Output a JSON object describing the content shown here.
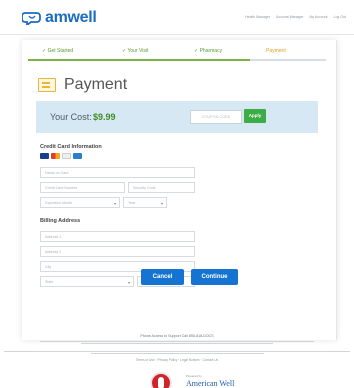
{
  "header": {
    "logo_text": "amwell",
    "links": [
      "Health Manager",
      "Account Manager",
      "My Account",
      "Log Out"
    ]
  },
  "steps": [
    {
      "label": "✓ Get Started",
      "state": "done"
    },
    {
      "label": "✓ Your Visit",
      "state": "done"
    },
    {
      "label": "✓ Pharmacy",
      "state": "done"
    },
    {
      "label": "Payment",
      "state": "active"
    }
  ],
  "page_title": "Payment",
  "cost": {
    "label": "Your Cost:",
    "amount": "$9.99",
    "coupon_placeholder": "COUPON CODE",
    "apply_label": "Apply"
  },
  "credit_card": {
    "section_title": "Credit Card Information",
    "card_types": [
      "visa-icon",
      "mastercard-icon",
      "discover-icon",
      "amex-icon"
    ],
    "name_placeholder": "Name on Card",
    "number_placeholder": "Credit Card Number",
    "security_placeholder": "Security Code",
    "month_placeholder": "Expiration Month",
    "year_placeholder": "Year"
  },
  "billing": {
    "section_title": "Billing Address",
    "address1_placeholder": "Address 1",
    "address2_placeholder": "Address 2",
    "city_placeholder": "City",
    "state_placeholder": "State",
    "zip_placeholder": "ZIP Code"
  },
  "buttons": {
    "cancel": "Cancel",
    "continue": "Continue"
  },
  "footer": {
    "support_text": "Phone Access to Support Call 855-818-DOCS",
    "links": [
      "Terms of Use",
      "Privacy Policy",
      "Legal Notices",
      "Contact Us"
    ],
    "powered_by": "Powered by",
    "partner_logo": "American Well"
  },
  "colors": {
    "brand_blue": "#1a6dc0",
    "button_blue": "#1573d2",
    "apply_green": "#3cad44",
    "step_green": "#5a9a2a",
    "step_active": "#e0a020",
    "cost_bg": "#d7e8f5"
  }
}
